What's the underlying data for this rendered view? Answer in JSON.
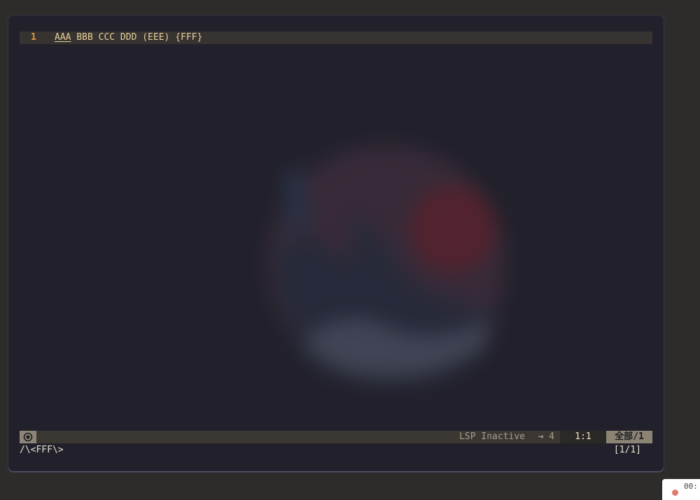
{
  "editor": {
    "line_number": "1",
    "match_text": "AAA",
    "rest_text": " BBB CCC DDD (EEE) {FFF}"
  },
  "modeline": {
    "mode_icon": "eye-icon",
    "lsp_status": "LSP Inactive",
    "indent_icon": "tab-arrow-icon",
    "indent_width": "4",
    "cursor_position": "1:1",
    "scope": "全部/1"
  },
  "minibuffer": {
    "query": "/\\<FFF\\>",
    "match_count": "[1/1]"
  },
  "notification": {
    "text": "00:"
  },
  "colors": {
    "window_bg": "#22212b",
    "line_number": "#e8953c",
    "text": "#e7cf9b",
    "highlight_line": "#363330",
    "modeline_bg": "#3b3833"
  }
}
